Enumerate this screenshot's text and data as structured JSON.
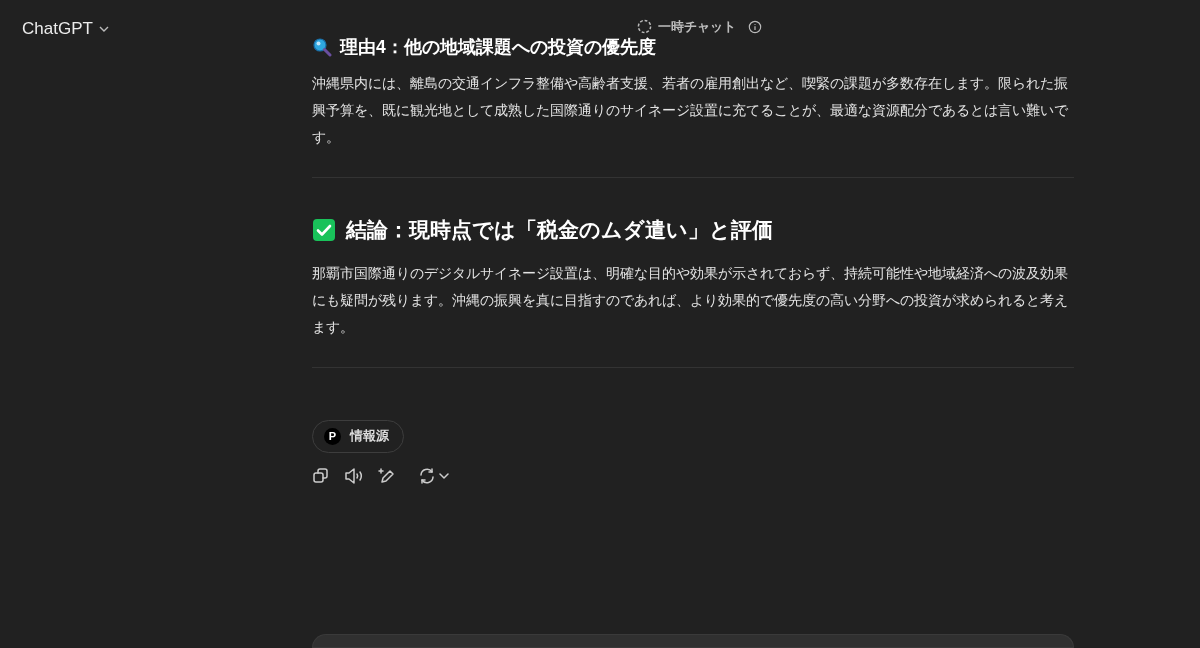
{
  "header": {
    "title": "ChatGPT",
    "temp_chat": "一時チャット"
  },
  "sections": [
    {
      "kind": "reason",
      "heading": "理由4：他の地域課題への投資の優先度",
      "body": "沖縄県内には、離島の交通インフラ整備や高齢者支援、若者の雇用創出など、喫緊の課題が多数存在します。限られた振興予算を、既に観光地として成熟した国際通りのサイネージ設置に充てることが、最適な資源配分であるとは言い難いです。"
    },
    {
      "kind": "conclusion",
      "heading": "結論：現時点では「税金のムダ遣い」と評価",
      "body": "那覇市国際通りのデジタルサイネージ設置は、明確な目的や効果が示されておらず、持続可能性や地域経済への波及効果にも疑問が残ります。沖縄の振興を真に目指すのであれば、より効果的で優先度の高い分野への投資が求められると考えます。"
    }
  ],
  "sources": {
    "badge": "P",
    "label": "情報源"
  }
}
